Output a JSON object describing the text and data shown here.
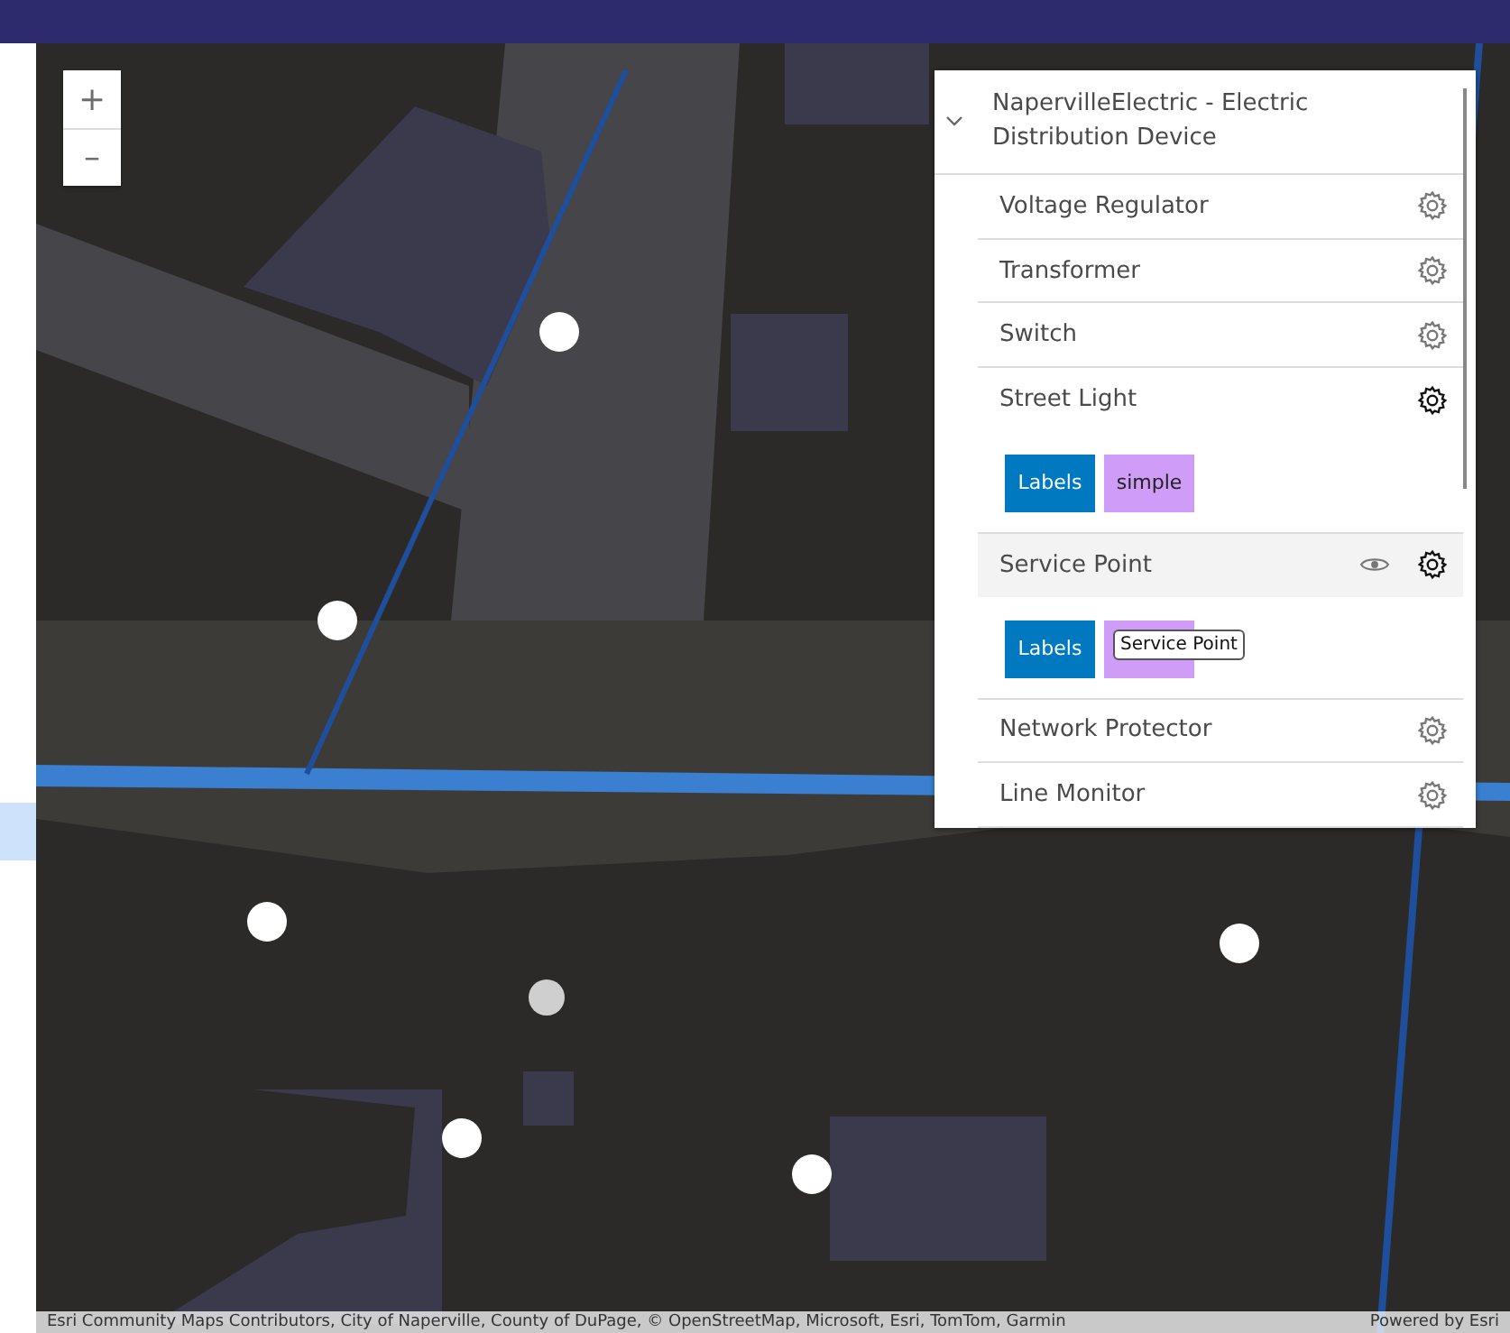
{
  "zoom_controls": [
    {
      "label": "+"
    },
    {
      "label": "–"
    }
  ],
  "layer_list": {
    "group": {
      "title": "NapervilleElectric - Electric Distribution Device",
      "expanded": true
    },
    "layers": [
      {
        "name": "Voltage Regulator",
        "highlighted": false,
        "expanded": false
      },
      {
        "name": "Transformer",
        "highlighted": false,
        "expanded": false
      },
      {
        "name": "Switch",
        "highlighted": false,
        "expanded": false
      },
      {
        "name": "Street Light",
        "highlighted": false,
        "expanded": true,
        "tags": [
          {
            "kind": "labels",
            "text": "Labels"
          },
          {
            "kind": "renderer",
            "text": "simple"
          }
        ]
      },
      {
        "name": "Service Point",
        "highlighted": true,
        "expanded": true,
        "tags": [
          {
            "kind": "labels",
            "text": "Labels"
          },
          {
            "kind": "renderer"
          }
        ],
        "tooltip": "Service Point"
      },
      {
        "name": "Network Protector",
        "highlighted": false,
        "expanded": false
      },
      {
        "name": "Line Monitor",
        "highlighted": false,
        "expanded": false
      }
    ]
  },
  "attribution": {
    "sources": "Esri Community Maps Contributors, City of Naperville, County of DuPage, © OpenStreetMap, Microsoft, Esri, TomTom, Garmin",
    "powered_by": "Powered by Esri"
  }
}
